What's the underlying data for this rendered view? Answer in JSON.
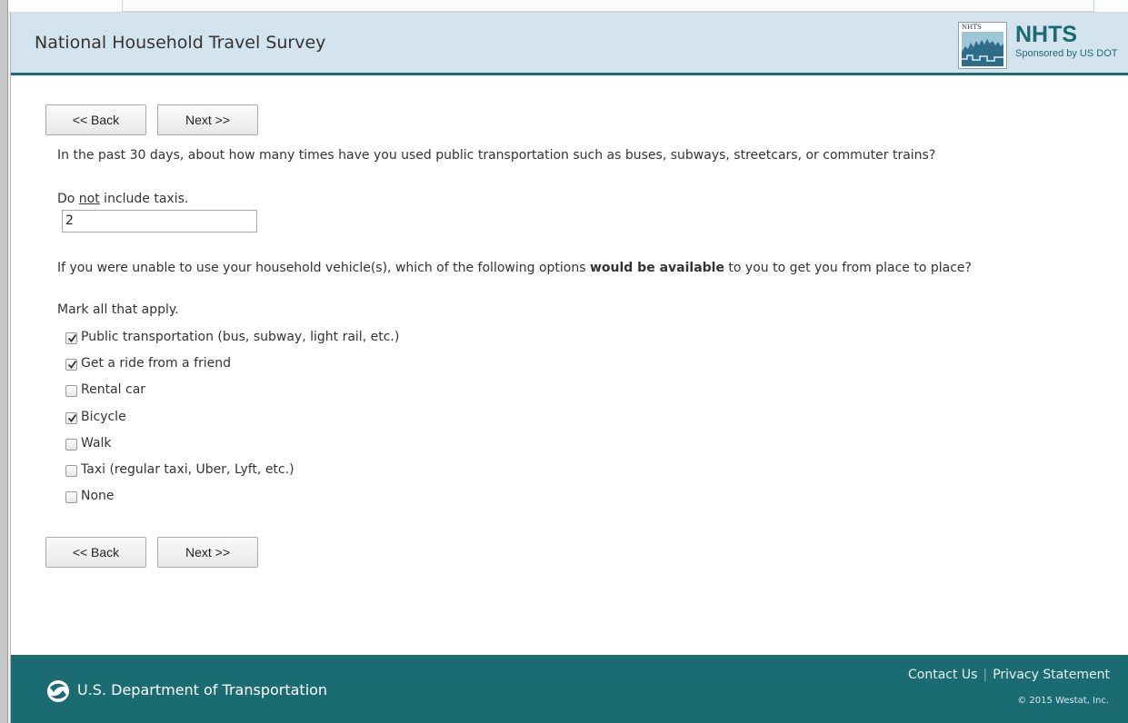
{
  "header": {
    "title": "National Household Travel Survey",
    "logo_small_text": "NHTS",
    "brand_name": "NHTS",
    "brand_sponsor": "Sponsored by US DOT"
  },
  "nav": {
    "back_label": "<< Back",
    "next_label": "Next >>"
  },
  "question1": {
    "text": "In the past 30 days, about how many times have you used public transportation such as buses, subways, streetcars, or commuter trains?",
    "note_prefix": "Do ",
    "note_emphasis": "not",
    "note_suffix": " include taxis.",
    "answer_value": "2"
  },
  "question2": {
    "text_before": "If you were unable to use your household vehicle(s), which of the following options ",
    "text_bold": "would be available",
    "text_after": " to you to get you from place to place?",
    "instruction": "Mark all that apply.",
    "options": [
      {
        "label": "Public transportation (bus, subway, light rail, etc.)",
        "checked": true
      },
      {
        "label": "Get a ride from a friend",
        "checked": true
      },
      {
        "label": "Rental car",
        "checked": false
      },
      {
        "label": "Bicycle",
        "checked": true
      },
      {
        "label": "Walk",
        "checked": false
      },
      {
        "label": "Taxi (regular taxi, Uber, Lyft, etc.)",
        "checked": false
      },
      {
        "label": "None",
        "checked": false
      }
    ]
  },
  "footer": {
    "department": "U.S. Department of Transportation",
    "contact_label": "Contact Us",
    "separator": "|",
    "privacy_label": "Privacy Statement",
    "copyright": "© 2015 Westat, Inc."
  },
  "colors": {
    "header_bg": "#d4e4ef",
    "brand_teal": "#1b6b72",
    "footer_bg": "#1b6b72"
  }
}
